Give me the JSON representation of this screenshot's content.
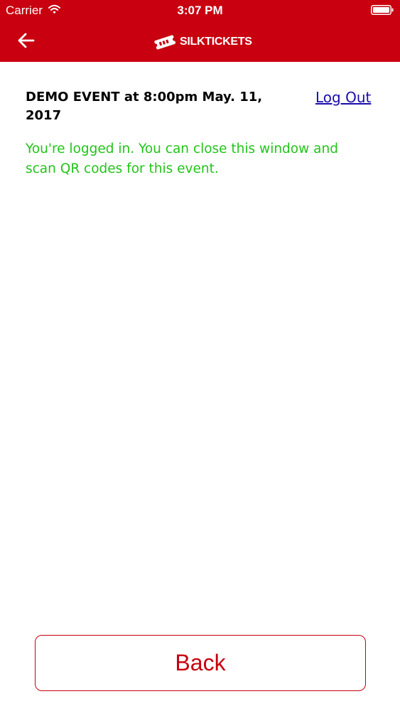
{
  "status_bar": {
    "carrier": "Carrier",
    "time": "3:07 PM"
  },
  "nav": {
    "back_icon": "arrow-left-icon",
    "logo_icon": "ticket-icon",
    "logo_text": "SILKTICKETS"
  },
  "event": {
    "title": "DEMO EVENT at 8:00pm May. 11, 2017",
    "logout_label": "Log Out",
    "status_message": "You're logged in. You can close this window and scan QR codes for this event."
  },
  "footer": {
    "back_label": "Back"
  },
  "colors": {
    "brand_red": "#c8000f",
    "success_green": "#22c41a",
    "link_blue": "#1a0dab"
  }
}
